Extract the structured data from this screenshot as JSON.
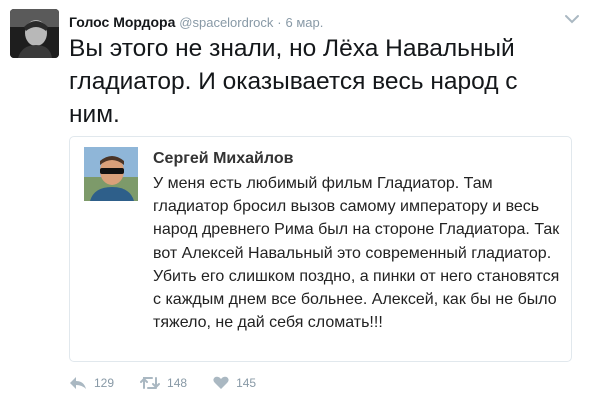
{
  "tweet": {
    "author_name": "Голос Мордора",
    "handle": "@spacelordrock",
    "separator": "·",
    "date": "6 мар.",
    "text": "Вы этого не знали, но Лёха Навальный гладиатор. И оказывается весь народ с ним."
  },
  "quote": {
    "author_name": "Сергей Михайлов",
    "text": "У меня есть любимый фильм Гладиатор. Там гладиатор бросил вызов самому императору и весь народ древнего Рима был на стороне Гладиатора. Так вот Алексей Навальный это современный гладиатор. Убить его слишком поздно, а пинки от него становятся с каждым днем все больнее. Алексей, как бы не было тяжело, не дай себя сломать!!!"
  },
  "actions": {
    "reply_count": "129",
    "retweet_count": "148",
    "like_count": "145"
  },
  "icons": {
    "reply": "reply-icon",
    "retweet": "retweet-icon",
    "like": "heart-icon",
    "menu": "chevron-down-icon"
  },
  "colors": {
    "text": "#14171a",
    "muted": "#8899a6",
    "border": "#e1e8ed"
  }
}
